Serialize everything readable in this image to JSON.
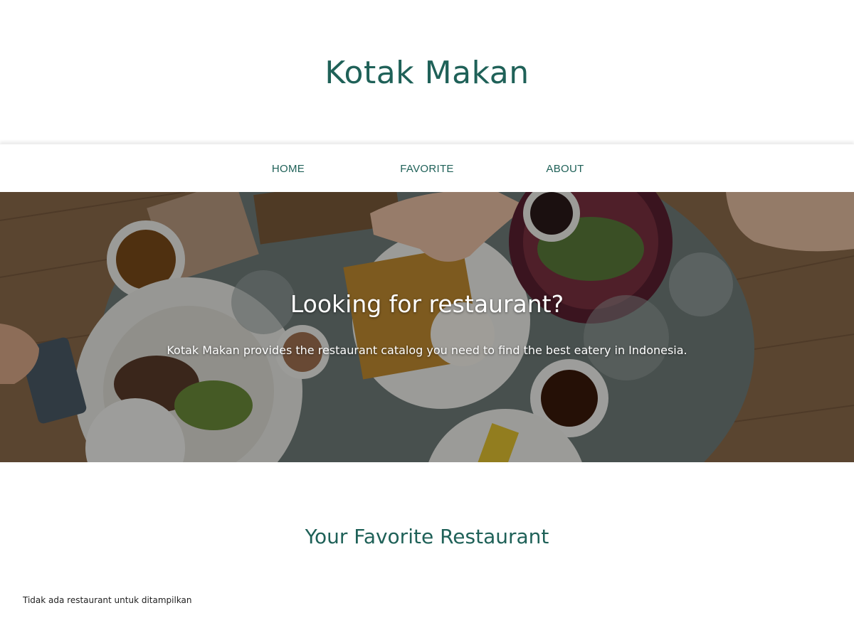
{
  "header": {
    "brand": "Kotak Makan"
  },
  "nav": {
    "items": [
      {
        "label": "HOME"
      },
      {
        "label": "FAVORITE"
      },
      {
        "label": "ABOUT"
      }
    ]
  },
  "hero": {
    "title": "Looking for restaurant?",
    "text": "Kotak Makan provides the restaurant catalog you need to find the best eatery in Indonesia."
  },
  "main": {
    "title": "Your Favorite Restaurant",
    "empty_message": "Tidak ada restaurant untuk ditampilkan"
  },
  "colors": {
    "brand": "#1f6158",
    "text": "#222222",
    "background": "#ffffff"
  }
}
